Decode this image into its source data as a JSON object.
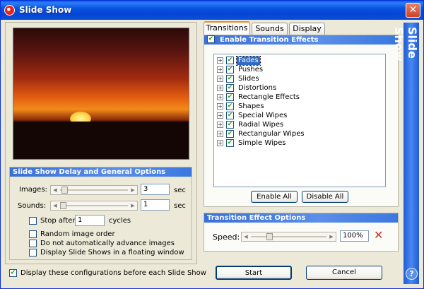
{
  "window": {
    "title": "Slide Show",
    "close_glyph": "✕",
    "banner_text": "Slide Show",
    "help_glyph": "?"
  },
  "left": {
    "general_header": "Slide Show Delay and General Options",
    "images_label": "Images:",
    "images_value": "3",
    "images_unit": "sec",
    "sounds_label": "Sounds:",
    "sounds_value": "1",
    "sounds_unit": "sec",
    "stop_after_label": "Stop after",
    "stop_after_value": "1",
    "stop_after_unit": "cycles",
    "options": [
      {
        "label": "Random image order",
        "checked": false
      },
      {
        "label": "Do not automatically advance images",
        "checked": false
      },
      {
        "label": "Display Slide Shows in a floating window",
        "checked": false
      }
    ],
    "display_config_label": "Display these configurations before each Slide Show"
  },
  "tabs": [
    {
      "label": "Transitions",
      "active": true
    },
    {
      "label": "Sounds",
      "active": false
    },
    {
      "label": "Display",
      "active": false
    }
  ],
  "transitions": {
    "enable_label": "Enable Transition Effects",
    "tree": [
      {
        "label": "Fades",
        "selected": true
      },
      {
        "label": "Pushes",
        "selected": false
      },
      {
        "label": "Slides",
        "selected": false
      },
      {
        "label": "Distortions",
        "selected": false
      },
      {
        "label": "Rectangle Effects",
        "selected": false
      },
      {
        "label": "Shapes",
        "selected": false
      },
      {
        "label": "Special Wipes",
        "selected": false
      },
      {
        "label": "Radial Wipes",
        "selected": false
      },
      {
        "label": "Rectangular Wipes",
        "selected": false
      },
      {
        "label": "Simple Wipes",
        "selected": false
      }
    ],
    "enable_all_label": "Enable All",
    "disable_all_label": "Disable All",
    "effect_options_header": "Transition Effect Options",
    "speed_label": "Speed:",
    "speed_value": "100%"
  },
  "footer": {
    "start_label": "Start",
    "cancel_label": "Cancel"
  },
  "sliders": {
    "images_level": 0.02,
    "sounds_level": 0.0,
    "speed_level": 0.22
  },
  "icons": {
    "check": "✔",
    "plus": "+",
    "arrow_left": "◀",
    "arrow_right": "▶",
    "delete": "✕"
  }
}
